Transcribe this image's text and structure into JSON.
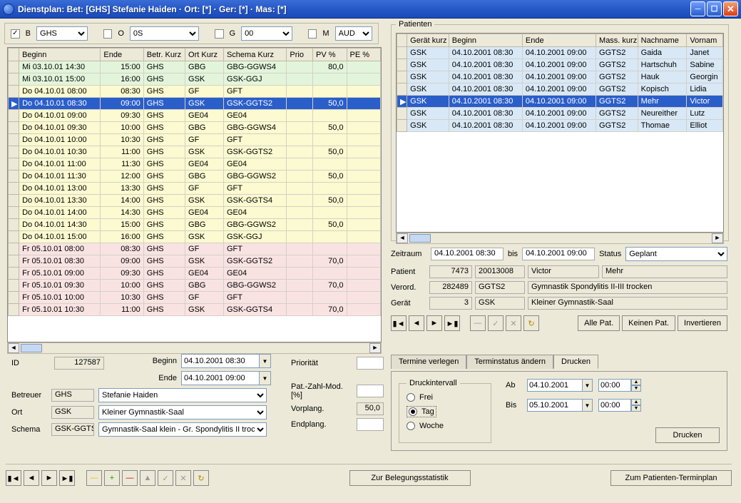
{
  "window": {
    "title": "Dienstplan: Bet: [GHS] Stefanie Haiden · Ort: [*] · Ger: [*] · Mas: [*]"
  },
  "filters": {
    "b_checked": "✓",
    "b_label": "B",
    "b_value": "GHS",
    "o_label": "O",
    "o_value": "0S",
    "g_label": "G",
    "g_value": "00",
    "m_label": "M",
    "m_value": "AUD"
  },
  "schedule": {
    "columns": [
      "Beginn",
      "Ende",
      "Betr. Kurz",
      "Ort Kurz",
      "Schema Kurz",
      "Prio",
      "PV %",
      "PE %"
    ],
    "rows": [
      {
        "cls": "green",
        "cols": [
          "Mi 03.10.01 14:30",
          "15:00",
          "GHS",
          "GBG",
          "GBG-GGWS4",
          "",
          "80,0",
          ""
        ]
      },
      {
        "cls": "green",
        "cols": [
          "Mi 03.10.01 15:00",
          "16:00",
          "GHS",
          "GSK",
          "GSK-GGJ",
          "",
          "",
          ""
        ]
      },
      {
        "cls": "yellow",
        "cols": [
          "Do 04.10.01 08:00",
          "08:30",
          "GHS",
          "GF",
          "GFT",
          "",
          "",
          ""
        ]
      },
      {
        "cls": "sel",
        "marker": "▶",
        "cols": [
          "Do 04.10.01 08:30",
          "09:00",
          "GHS",
          "GSK",
          "GSK-GGTS2",
          "",
          "50,0",
          ""
        ]
      },
      {
        "cls": "yellow",
        "cols": [
          "Do 04.10.01 09:00",
          "09:30",
          "GHS",
          "GE04",
          "GE04",
          "",
          "",
          ""
        ]
      },
      {
        "cls": "yellow",
        "cols": [
          "Do 04.10.01 09:30",
          "10:00",
          "GHS",
          "GBG",
          "GBG-GGWS4",
          "",
          "50,0",
          ""
        ]
      },
      {
        "cls": "yellow",
        "cols": [
          "Do 04.10.01 10:00",
          "10:30",
          "GHS",
          "GF",
          "GFT",
          "",
          "",
          ""
        ]
      },
      {
        "cls": "yellow",
        "cols": [
          "Do 04.10.01 10:30",
          "11:00",
          "GHS",
          "GSK",
          "GSK-GGTS2",
          "",
          "50,0",
          ""
        ]
      },
      {
        "cls": "yellow",
        "cols": [
          "Do 04.10.01 11:00",
          "11:30",
          "GHS",
          "GE04",
          "GE04",
          "",
          "",
          ""
        ]
      },
      {
        "cls": "yellow",
        "cols": [
          "Do 04.10.01 11:30",
          "12:00",
          "GHS",
          "GBG",
          "GBG-GGWS2",
          "",
          "50,0",
          ""
        ]
      },
      {
        "cls": "yellow",
        "cols": [
          "Do 04.10.01 13:00",
          "13:30",
          "GHS",
          "GF",
          "GFT",
          "",
          "",
          ""
        ]
      },
      {
        "cls": "yellow",
        "cols": [
          "Do 04.10.01 13:30",
          "14:00",
          "GHS",
          "GSK",
          "GSK-GGTS4",
          "",
          "50,0",
          ""
        ]
      },
      {
        "cls": "yellow",
        "cols": [
          "Do 04.10.01 14:00",
          "14:30",
          "GHS",
          "GE04",
          "GE04",
          "",
          "",
          ""
        ]
      },
      {
        "cls": "yellow",
        "cols": [
          "Do 04.10.01 14:30",
          "15:00",
          "GHS",
          "GBG",
          "GBG-GGWS2",
          "",
          "50,0",
          ""
        ]
      },
      {
        "cls": "yellow",
        "cols": [
          "Do 04.10.01 15:00",
          "16:00",
          "GHS",
          "GSK",
          "GSK-GGJ",
          "",
          "",
          ""
        ]
      },
      {
        "cls": "pink",
        "cols": [
          "Fr 05.10.01 08:00",
          "08:30",
          "GHS",
          "GF",
          "GFT",
          "",
          "",
          ""
        ]
      },
      {
        "cls": "pink",
        "cols": [
          "Fr 05.10.01 08:30",
          "09:00",
          "GHS",
          "GSK",
          "GSK-GGTS2",
          "",
          "70,0",
          ""
        ]
      },
      {
        "cls": "pink",
        "cols": [
          "Fr 05.10.01 09:00",
          "09:30",
          "GHS",
          "GE04",
          "GE04",
          "",
          "",
          ""
        ]
      },
      {
        "cls": "pink",
        "cols": [
          "Fr 05.10.01 09:30",
          "10:00",
          "GHS",
          "GBG",
          "GBG-GGWS2",
          "",
          "70,0",
          ""
        ]
      },
      {
        "cls": "pink",
        "cols": [
          "Fr 05.10.01 10:00",
          "10:30",
          "GHS",
          "GF",
          "GFT",
          "",
          "",
          ""
        ]
      },
      {
        "cls": "pink",
        "cols": [
          "Fr 05.10.01 10:30",
          "11:00",
          "GHS",
          "GSK",
          "GSK-GGTS4",
          "",
          "70,0",
          ""
        ]
      }
    ]
  },
  "patients": {
    "legend": "Patienten",
    "columns": [
      "Gerät kurz",
      "Beginn",
      "Ende",
      "Mass. kurz",
      "Nachname",
      "Vornam"
    ],
    "rows": [
      {
        "cls": "blue",
        "cols": [
          "GSK",
          "04.10.2001 08:30",
          "04.10.2001 09:00",
          "GGTS2",
          "Gaida",
          "Janet"
        ]
      },
      {
        "cls": "blue",
        "cols": [
          "GSK",
          "04.10.2001 08:30",
          "04.10.2001 09:00",
          "GGTS2",
          "Hartschuh",
          "Sabine"
        ]
      },
      {
        "cls": "blue",
        "cols": [
          "GSK",
          "04.10.2001 08:30",
          "04.10.2001 09:00",
          "GGTS2",
          "Hauk",
          "Georgin"
        ]
      },
      {
        "cls": "blue",
        "cols": [
          "GSK",
          "04.10.2001 08:30",
          "04.10.2001 09:00",
          "GGTS2",
          "Kopisch",
          "Lidia"
        ]
      },
      {
        "cls": "sel",
        "marker": "▶",
        "cols": [
          "GSK",
          "04.10.2001 08:30",
          "04.10.2001 09:00",
          "GGTS2",
          "Mehr",
          "Victor"
        ]
      },
      {
        "cls": "blue",
        "cols": [
          "GSK",
          "04.10.2001 08:30",
          "04.10.2001 09:00",
          "GGTS2",
          "Neureither",
          "Lutz"
        ]
      },
      {
        "cls": "blue",
        "cols": [
          "GSK",
          "04.10.2001 08:30",
          "04.10.2001 09:00",
          "GGTS2",
          "Thomae",
          "Elliot"
        ]
      }
    ]
  },
  "zeitraum": {
    "label": "Zeitraum",
    "from": "04.10.2001 08:30",
    "bis_label": "bis",
    "to": "04.10.2001 09:00",
    "status_label": "Status",
    "status_value": "Geplant"
  },
  "patient": {
    "label": "Patient",
    "id": "7473",
    "code": "20013008",
    "first": "Victor",
    "last": "Mehr"
  },
  "verord": {
    "label": "Verord.",
    "id": "282489",
    "code": "GGTS2",
    "desc": "Gymnastik Spondylitis II-III trocken"
  },
  "geraet": {
    "label": "Gerät",
    "id": "3",
    "code": "GSK",
    "desc": "Kleiner Gymnastik-Saal"
  },
  "buttons": {
    "alle": "Alle Pat.",
    "keine": "Keinen Pat.",
    "invert": "Invertieren"
  },
  "left_detail": {
    "id_label": "ID",
    "id_value": "127587",
    "beginn_label": "Beginn",
    "beginn_value": "04.10.2001 08:30",
    "ende_label": "Ende",
    "ende_value": "04.10.2001 09:00",
    "betreuer_label": "Betreuer",
    "betreuer_code": "GHS",
    "betreuer_name": "Stefanie Haiden",
    "ort_label": "Ort",
    "ort_code": "GSK",
    "ort_name": "Kleiner Gymnastik-Saal",
    "schema_label": "Schema",
    "schema_code": "GSK-GGTS",
    "schema_name": "Gymnastik-Saal klein - Gr. Spondylitis II trocken",
    "prio_label": "Priorität",
    "prio_value": "",
    "mod_label": "Pat.-Zahl-Mod. [%]",
    "mod_value": "",
    "vor_label": "Vorplang.",
    "vor_value": "50,0",
    "end_label": "Endplang.",
    "end_value": ""
  },
  "tabs": {
    "t1": "Termine verlegen",
    "t2": "Terminstatus ändern",
    "t3": "Drucken"
  },
  "print": {
    "interval_legend": "Druckintervall",
    "frei": "Frei",
    "tag": "Tag",
    "woche": "Woche",
    "ab_label": "Ab",
    "ab_date": "04.10.2001",
    "ab_time": "00:00",
    "bis_label": "Bis",
    "bis_date": "05.10.2001",
    "bis_time": "00:00",
    "button": "Drucken"
  },
  "bottom": {
    "belegung": "Zur Belegungsstatistik",
    "terminplan": "Zum Patienten-Terminplan"
  }
}
